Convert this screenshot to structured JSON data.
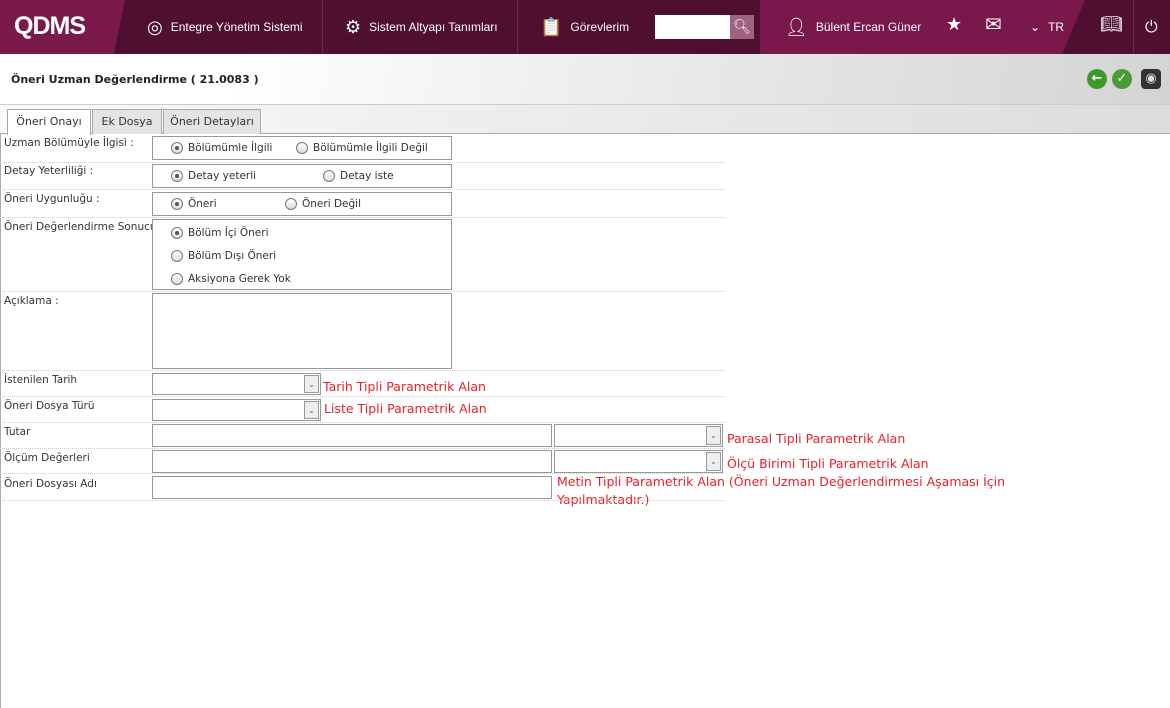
{
  "header": {
    "logo": "QDMS",
    "menu": [
      {
        "label": "Entegre Yönetim Sistemi",
        "icon": "q-icon"
      },
      {
        "label": "Sistem Altyapı Tanımları",
        "icon": "gear-icon"
      },
      {
        "label": "Görevlerim",
        "icon": "clipboard-icon"
      }
    ],
    "search_value": "",
    "user": "Bülent Ercan Güner",
    "language": "TR"
  },
  "page": {
    "title": "Öneri Uzman Değerlendirme ( 21.0083 )",
    "tabs": [
      "Öneri Onayı",
      "Ek Dosya",
      "Öneri Detayları"
    ],
    "active_tab": "Öneri Onayı"
  },
  "form": {
    "uzman": {
      "label": "Uzman Bölümüyle İlgisi :",
      "options": [
        "Bölümümle İlgili",
        "Bölümümle İlgili Değil"
      ],
      "selected": 0
    },
    "detay": {
      "label": "Detay Yeterliliği :",
      "options": [
        "Detay yeterli",
        "Detay iste"
      ],
      "selected": 0
    },
    "uygunluk": {
      "label": "Öneri Uygunluğu :",
      "options": [
        "Öneri",
        "Öneri Değil"
      ],
      "selected": 0
    },
    "sonuc": {
      "label": "Öneri Değerlendirme Sonucu :",
      "options": [
        "Bölüm İçi Öneri",
        "Bölüm Dışı Öneri",
        "Aksiyona Gerek Yok"
      ],
      "selected": 0
    },
    "aciklama": {
      "label": "Açıklama :",
      "value": ""
    },
    "tarih": {
      "label": "İstenilen Tarih",
      "value": "",
      "note": "Tarih Tipli Parametrik Alan"
    },
    "dosya_turu": {
      "label": "Öneri Dosya Türü",
      "value": "",
      "note": "Liste Tipli Parametrik Alan"
    },
    "tutar": {
      "label": "Tutar",
      "value": "",
      "currency": "",
      "note": "Parasal Tipli Parametrik Alan"
    },
    "olcum": {
      "label": "Ölçüm Değerleri",
      "value": "",
      "unit": "",
      "note": "Ölçü Birimi Tipli Parametrik Alan"
    },
    "dosya_adi": {
      "label": "Öneri Dosyası Adı",
      "value": "",
      "note": "Metin Tipli Parametrik Alan (Öneri Uzman Değerlendirmesi Aşaması İçin Yapılmaktadır.)"
    }
  }
}
